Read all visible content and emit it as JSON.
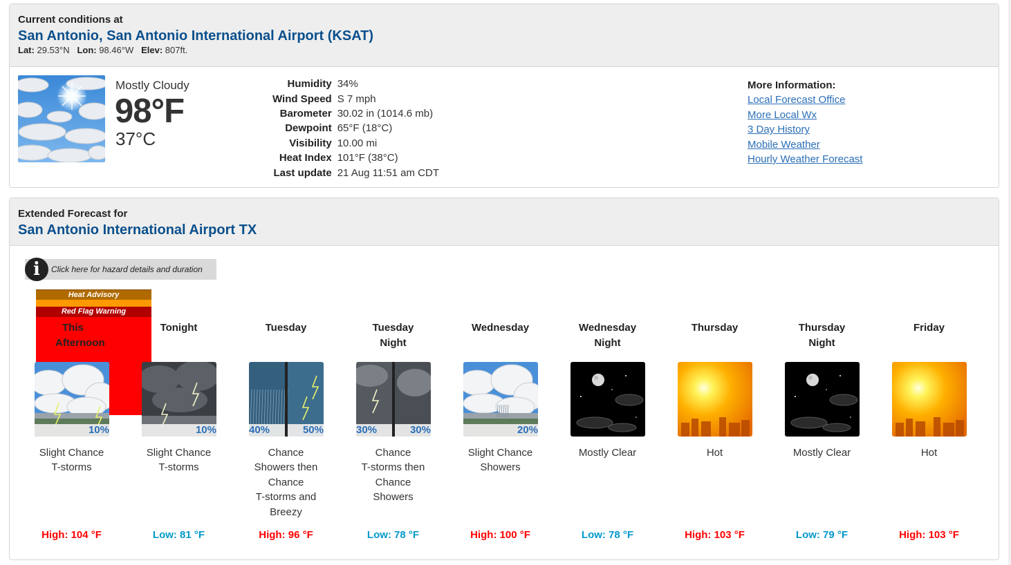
{
  "current": {
    "header_label": "Current conditions at",
    "station": "San Antonio, San Antonio International Airport (KSAT)",
    "lat_label": "Lat:",
    "lat": "29.53°N",
    "lon_label": "Lon:",
    "lon": "98.46°W",
    "elev_label": "Elev:",
    "elev": "807ft.",
    "summary": "Mostly Cloudy",
    "temp_f": "98°F",
    "temp_c": "37°C",
    "details": [
      {
        "label": "Humidity",
        "value": "34%"
      },
      {
        "label": "Wind Speed",
        "value": "S 7 mph"
      },
      {
        "label": "Barometer",
        "value": "30.02 in (1014.6 mb)"
      },
      {
        "label": "Dewpoint",
        "value": "65°F (18°C)"
      },
      {
        "label": "Visibility",
        "value": "10.00 mi"
      },
      {
        "label": "Heat Index",
        "value": "101°F (38°C)"
      },
      {
        "label": "Last update",
        "value": "21 Aug 11:51 am CDT"
      }
    ],
    "more_info": {
      "heading": "More Information:",
      "links": [
        "Local Forecast Office",
        "More Local Wx",
        "3 Day History",
        "Mobile Weather",
        "Hourly Weather Forecast"
      ]
    }
  },
  "extended": {
    "header_label": "Extended Forecast for",
    "location": "San Antonio International Airport TX",
    "hazard_button": "Click here for hazard details and duration",
    "hazards": [
      "Heat Advisory",
      "Red Flag Warning"
    ],
    "periods": [
      {
        "name1": "This",
        "name2": "Afternoon",
        "icon": "tstorm-day-icon",
        "pops": [
          "10%"
        ],
        "desc": [
          "Slight Chance",
          "T-storms"
        ],
        "temp": "High: 104 °F",
        "kind": "hi"
      },
      {
        "name1": "Tonight",
        "name2": "",
        "icon": "tstorm-night-icon",
        "pops": [
          "10%"
        ],
        "desc": [
          "Slight Chance",
          "T-storms"
        ],
        "temp": "Low: 81 °F",
        "kind": "lo"
      },
      {
        "name1": "Tuesday",
        "name2": "",
        "icon": "showers-tstorm-split-icon",
        "pops": [
          "40%",
          "50%"
        ],
        "desc": [
          "Chance",
          "Showers then",
          "Chance",
          "T-storms and",
          "Breezy"
        ],
        "temp": "High: 96 °F",
        "kind": "hi"
      },
      {
        "name1": "Tuesday",
        "name2": "Night",
        "icon": "tstorm-showers-split-icon",
        "pops": [
          "30%",
          "30%"
        ],
        "desc": [
          "Chance",
          "T-storms then",
          "Chance",
          "Showers"
        ],
        "temp": "Low: 78 °F",
        "kind": "lo"
      },
      {
        "name1": "Wednesday",
        "name2": "",
        "icon": "showers-day-icon",
        "pops": [
          "20%"
        ],
        "desc": [
          "Slight Chance",
          "Showers"
        ],
        "temp": "High: 100 °F",
        "kind": "hi"
      },
      {
        "name1": "Wednesday",
        "name2": "Night",
        "icon": "clear-night-icon",
        "pops": [],
        "desc": [
          "Mostly Clear"
        ],
        "temp": "Low: 78 °F",
        "kind": "lo"
      },
      {
        "name1": "Thursday",
        "name2": "",
        "icon": "hot-sun-icon",
        "pops": [],
        "desc": [
          "Hot"
        ],
        "temp": "High: 103 °F",
        "kind": "hi"
      },
      {
        "name1": "Thursday",
        "name2": "Night",
        "icon": "clear-night-icon",
        "pops": [],
        "desc": [
          "Mostly Clear"
        ],
        "temp": "Low: 79 °F",
        "kind": "lo"
      },
      {
        "name1": "Friday",
        "name2": "",
        "icon": "hot-sun-icon",
        "pops": [],
        "desc": [
          "Hot"
        ],
        "temp": "High: 103 °F",
        "kind": "hi"
      }
    ]
  }
}
